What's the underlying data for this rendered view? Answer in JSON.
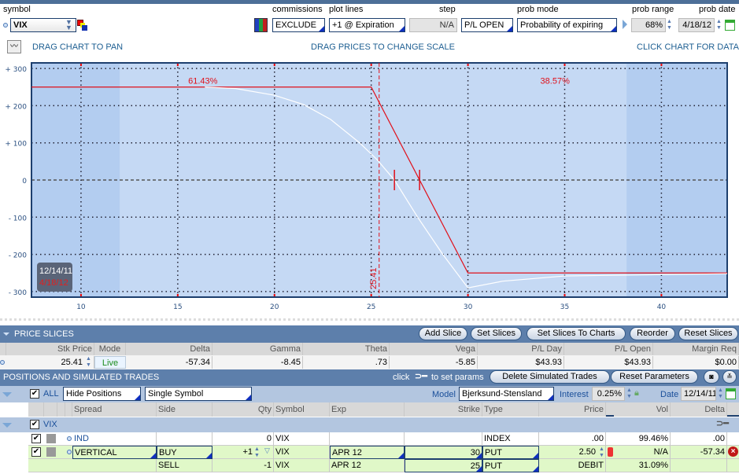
{
  "toolbar": {
    "symbol_label": "symbol",
    "symbol_value": "VIX",
    "commissions_label": "commissions",
    "commissions_value": "EXCLUDE",
    "plot_lines_label": "plot lines",
    "plot_lines_value": "+1 @ Expiration",
    "step_label": "step",
    "step_value": "N/A",
    "pl_mode_value": "P/L OPEN",
    "prob_mode_label": "prob mode",
    "prob_mode_value": "Probability of expiring",
    "prob_range_label": "prob range",
    "prob_range_value": "68%",
    "prob_date_label": "prob date",
    "prob_date_value": "4/18/12"
  },
  "hints": {
    "pan": "DRAG CHART TO PAN",
    "scale": "DRAG PRICES TO CHANGE SCALE",
    "data": "CLICK CHART FOR DATA"
  },
  "chart_data": {
    "type": "line",
    "xlim": [
      7.44,
      43.4
    ],
    "ylim": [
      -315,
      315
    ],
    "xticks": [
      "10",
      "15",
      "20",
      "25",
      "30",
      "35",
      "40"
    ],
    "xtick_values": [
      10,
      15,
      20,
      25,
      30,
      35,
      40
    ],
    "yticks": [
      "+ 300",
      "+ 200",
      "+ 100",
      "0",
      "- 100",
      "- 200",
      "- 300"
    ],
    "ytick_values": [
      300,
      200,
      100,
      0,
      -100,
      -200,
      -300
    ],
    "prob_range": [
      12,
      38.2
    ],
    "current_price": 25.41,
    "current_price_label": "25.41",
    "breakevens": [
      26.2,
      27.5
    ],
    "prob_left": "61.43%",
    "prob_right": "38.57%",
    "date_today": "12/14/11",
    "date_exp": "4/18/12",
    "series": [
      {
        "name": "expiration",
        "color": "#e0101a",
        "x": [
          7.44,
          25,
          30,
          43.4
        ],
        "y": [
          250,
          250,
          -250,
          -250
        ]
      },
      {
        "name": "today",
        "color": "#ffffff",
        "x": [
          16.4,
          18,
          20,
          21.5,
          22.9,
          24.4,
          25.3,
          26.2,
          27.4,
          28.7,
          30,
          31.8,
          35,
          43.4
        ],
        "y": [
          250,
          246,
          228,
          203,
          163,
          100,
          55,
          0,
          -100,
          -200,
          -290,
          -272,
          -258,
          -252
        ]
      }
    ]
  },
  "price_slices": {
    "title": "PRICE SLICES",
    "buttons": [
      "Add Slice",
      "Set Slices",
      "Set Slices To Charts",
      "Reorder",
      "Reset Slices"
    ],
    "headers": [
      "Stk Price",
      "Mode",
      "Delta",
      "Gamma",
      "Theta",
      "Vega",
      "P/L Day",
      "P/L Open",
      "Margin Req"
    ],
    "row": [
      "25.41",
      "Live",
      "-57.34",
      "-8.45",
      ".73",
      "-5.85",
      "$43.93",
      "$43.93",
      "$0.00"
    ]
  },
  "positions": {
    "title": "POSITIONS AND SIMULATED TRADES",
    "click_hint_pre": "click",
    "click_hint_post": "to set params",
    "delete_btn": "Delete Simulated Trades",
    "reset_btn": "Reset Parameters",
    "all_label": "ALL",
    "hide_positions": "Hide Positions",
    "single_symbol": "Single Symbol",
    "model_label": "Model",
    "model_value": "Bjerksund-Stensland",
    "interest_label": "Interest",
    "interest_value": "0.25%",
    "date_label": "Date",
    "date_value": "12/14/11",
    "headers": [
      "Spread",
      "Side",
      "Qty",
      "Symbol",
      "Exp",
      "Strike",
      "Type",
      "Price",
      "Vol",
      "Delta"
    ],
    "group": "VIX",
    "rows": [
      [
        "IND",
        "",
        "0",
        "VIX",
        "",
        "",
        "INDEX",
        ".00",
        "99.46%",
        ".00"
      ],
      [
        "VERTICAL",
        "BUY",
        "+1",
        "VIX",
        "APR 12",
        "30",
        "PUT",
        "2.50",
        "N/A",
        "-57.34"
      ],
      [
        "",
        "SELL",
        "-1",
        "VIX",
        "APR 12",
        "25",
        "PUT",
        "DEBIT",
        "31.09%",
        ""
      ]
    ]
  }
}
